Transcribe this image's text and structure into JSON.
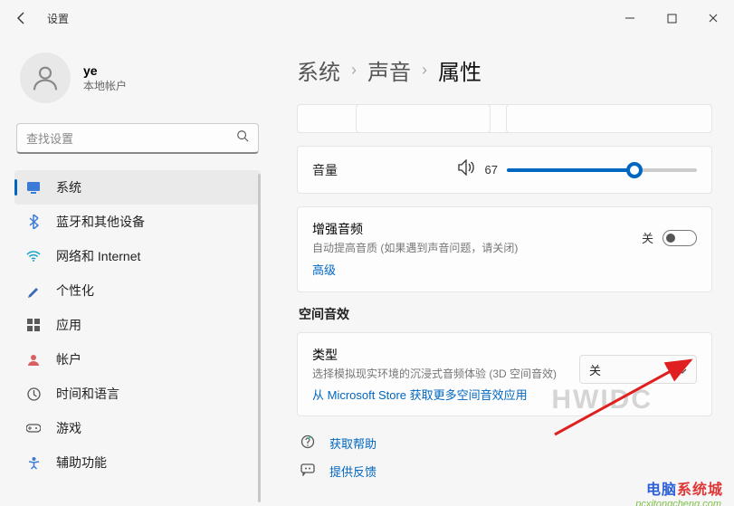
{
  "window": {
    "title": "设置",
    "min": "—",
    "max": "▢",
    "close": "✕"
  },
  "user": {
    "name": "ye",
    "account_type": "本地帐户"
  },
  "search": {
    "placeholder": "查找设置"
  },
  "sidebar": {
    "items": [
      {
        "label": "系统",
        "icon": "display-icon",
        "color": "#3a7bd5"
      },
      {
        "label": "蓝牙和其他设备",
        "icon": "bluetooth-icon",
        "color": "#3a7bd5"
      },
      {
        "label": "网络和 Internet",
        "icon": "wifi-icon",
        "color": "#1aa3c7"
      },
      {
        "label": "个性化",
        "icon": "brush-icon",
        "color": "#3e6bb8"
      },
      {
        "label": "应用",
        "icon": "apps-icon",
        "color": "#5a5a5a"
      },
      {
        "label": "帐户",
        "icon": "account-icon",
        "color": "#d86060"
      },
      {
        "label": "时间和语言",
        "icon": "clock-icon",
        "color": "#555"
      },
      {
        "label": "游戏",
        "icon": "game-icon",
        "color": "#555"
      },
      {
        "label": "辅助功能",
        "icon": "accessibility-icon",
        "color": "#3a7bd5"
      }
    ]
  },
  "breadcrumb": {
    "a": "系统",
    "b": "声音",
    "c": "属性"
  },
  "volume": {
    "label": "音量",
    "value": "67"
  },
  "enhance": {
    "title": "增强音频",
    "sub": "自动提高音质 (如果遇到声音问题，请关闭)",
    "link": "高级",
    "state": "关"
  },
  "spatial": {
    "section": "空间音效",
    "title": "类型",
    "sub": "选择模拟现实环境的沉浸式音频体验 (3D 空间音效)",
    "link": "从 Microsoft Store 获取更多空间音效应用",
    "value": "关"
  },
  "help": {
    "get_help": "获取帮助",
    "feedback": "提供反馈"
  },
  "watermark": {
    "a": "电脑",
    "b": "系统城",
    "url": "pcxitongcheng.com",
    "bg": "HWIDC"
  }
}
